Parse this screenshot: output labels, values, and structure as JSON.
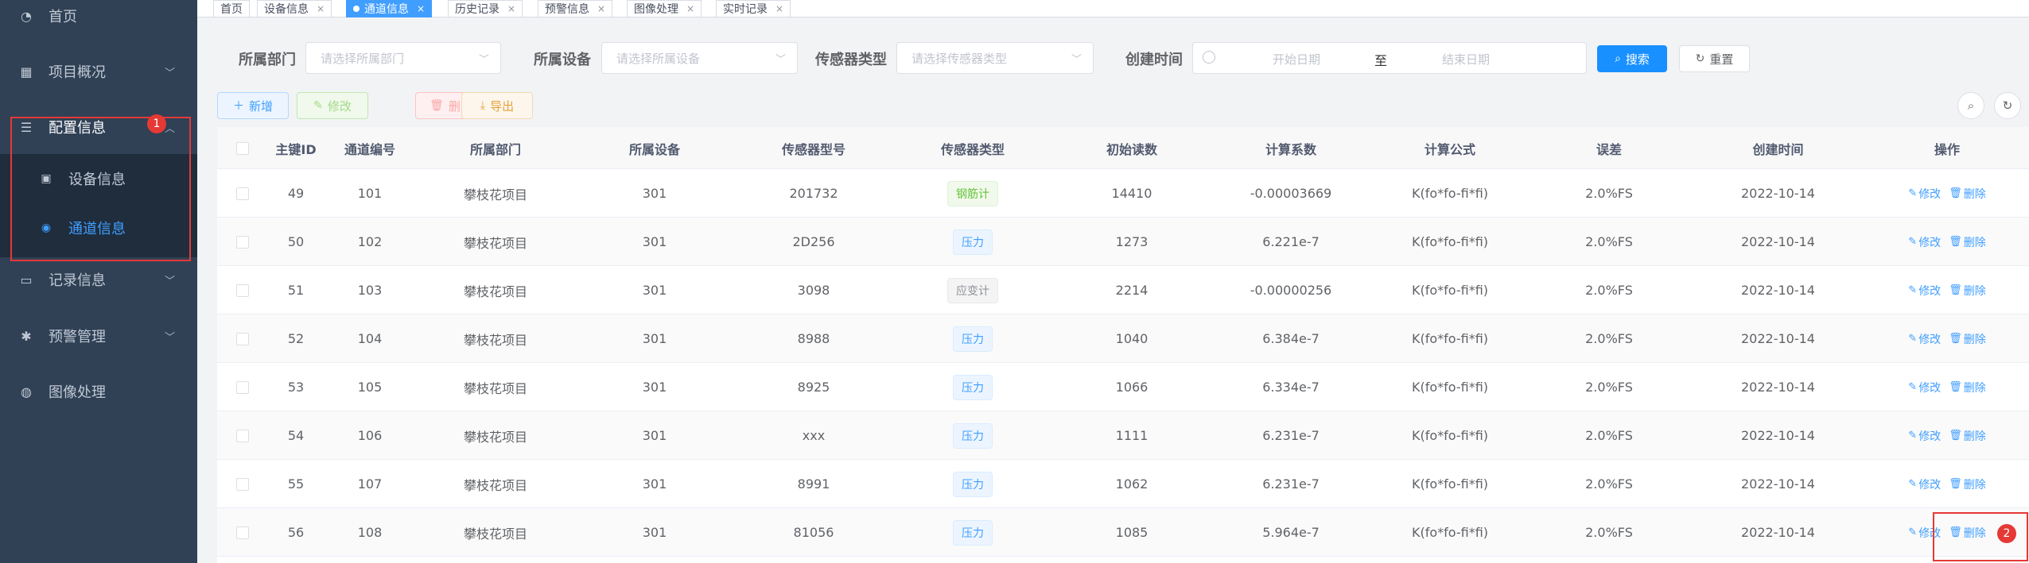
{
  "sidebar": {
    "items": [
      {
        "label": "首页",
        "icon": "dashboard-icon"
      },
      {
        "label": "项目概况",
        "icon": "table-icon"
      },
      {
        "label": "配置信息",
        "icon": "sliders-icon"
      },
      {
        "label": "记录信息",
        "icon": "monitor-icon"
      },
      {
        "label": "预警管理",
        "icon": "bug-icon"
      },
      {
        "label": "图像处理",
        "icon": "globe-icon"
      }
    ],
    "submenu": [
      {
        "label": "设备信息",
        "icon": "briefcase-icon"
      },
      {
        "label": "通道信息",
        "icon": "radio-dot-icon"
      }
    ],
    "annotation_1": "1"
  },
  "tags": [
    {
      "label": "首页"
    },
    {
      "label": "设备信息"
    },
    {
      "label": "通道信息"
    },
    {
      "label": "历史记录"
    },
    {
      "label": "预警信息"
    },
    {
      "label": "图像处理"
    },
    {
      "label": "实时记录"
    }
  ],
  "search": {
    "dept_label": "所属部门",
    "dept_placeholder": "请选择所属部门",
    "device_label": "所属设备",
    "device_placeholder": "请选择所属设备",
    "sensor_label": "传感器类型",
    "sensor_placeholder": "请选择传感器类型",
    "time_label": "创建时间",
    "start_placeholder": "开始日期",
    "range_sep": "至",
    "end_placeholder": "结束日期",
    "search_button": "搜索",
    "reset_button": "重置"
  },
  "toolbar": {
    "add": "新增",
    "edit": "修改",
    "delete": "删除",
    "export": "导出"
  },
  "table": {
    "headers": [
      "主键ID",
      "通道编号",
      "所属部门",
      "所属设备",
      "传感器型号",
      "传感器类型",
      "初始读数",
      "计算系数",
      "计算公式",
      "误差",
      "创建时间",
      "操作"
    ],
    "edit_label": "修改",
    "delete_label": "删除",
    "rows": [
      {
        "id": "49",
        "channel": "101",
        "dept": "攀枝花项目",
        "device": "301",
        "model": "201732",
        "type": "钢筋计",
        "type_style": "success",
        "init": "14410",
        "coef": "-0.00003669",
        "formula": "K(fo*fo-fi*fi)",
        "error": "2.0%FS",
        "created": "2022-10-14"
      },
      {
        "id": "50",
        "channel": "102",
        "dept": "攀枝花项目",
        "device": "301",
        "model": "2D256",
        "type": "压力",
        "type_style": "primary",
        "init": "1273",
        "coef": "6.221e-7",
        "formula": "K(fo*fo-fi*fi)",
        "error": "2.0%FS",
        "created": "2022-10-14"
      },
      {
        "id": "51",
        "channel": "103",
        "dept": "攀枝花项目",
        "device": "301",
        "model": "3098",
        "type": "应变计",
        "type_style": "info",
        "init": "2214",
        "coef": "-0.00000256",
        "formula": "K(fo*fo-fi*fi)",
        "error": "2.0%FS",
        "created": "2022-10-14"
      },
      {
        "id": "52",
        "channel": "104",
        "dept": "攀枝花项目",
        "device": "301",
        "model": "8988",
        "type": "压力",
        "type_style": "primary",
        "init": "1040",
        "coef": "6.384e-7",
        "formula": "K(fo*fo-fi*fi)",
        "error": "2.0%FS",
        "created": "2022-10-14"
      },
      {
        "id": "53",
        "channel": "105",
        "dept": "攀枝花项目",
        "device": "301",
        "model": "8925",
        "type": "压力",
        "type_style": "primary",
        "init": "1066",
        "coef": "6.334e-7",
        "formula": "K(fo*fo-fi*fi)",
        "error": "2.0%FS",
        "created": "2022-10-14"
      },
      {
        "id": "54",
        "channel": "106",
        "dept": "攀枝花项目",
        "device": "301",
        "model": "xxx",
        "type": "压力",
        "type_style": "primary",
        "init": "1111",
        "coef": "6.231e-7",
        "formula": "K(fo*fo-fi*fi)",
        "error": "2.0%FS",
        "created": "2022-10-14"
      },
      {
        "id": "55",
        "channel": "107",
        "dept": "攀枝花项目",
        "device": "301",
        "model": "8991",
        "type": "压力",
        "type_style": "primary",
        "init": "1062",
        "coef": "6.231e-7",
        "formula": "K(fo*fo-fi*fi)",
        "error": "2.0%FS",
        "created": "2022-10-14"
      },
      {
        "id": "56",
        "channel": "108",
        "dept": "攀枝花项目",
        "device": "301",
        "model": "81056",
        "type": "压力",
        "type_style": "primary",
        "init": "1085",
        "coef": "5.964e-7",
        "formula": "K(fo*fo-fi*fi)",
        "error": "2.0%FS",
        "created": "2022-10-14"
      }
    ]
  },
  "annotation_2": "2",
  "colors": {
    "sidebar_bg": "#304156",
    "accent": "#409eff",
    "highlight_red": "#e53935"
  }
}
